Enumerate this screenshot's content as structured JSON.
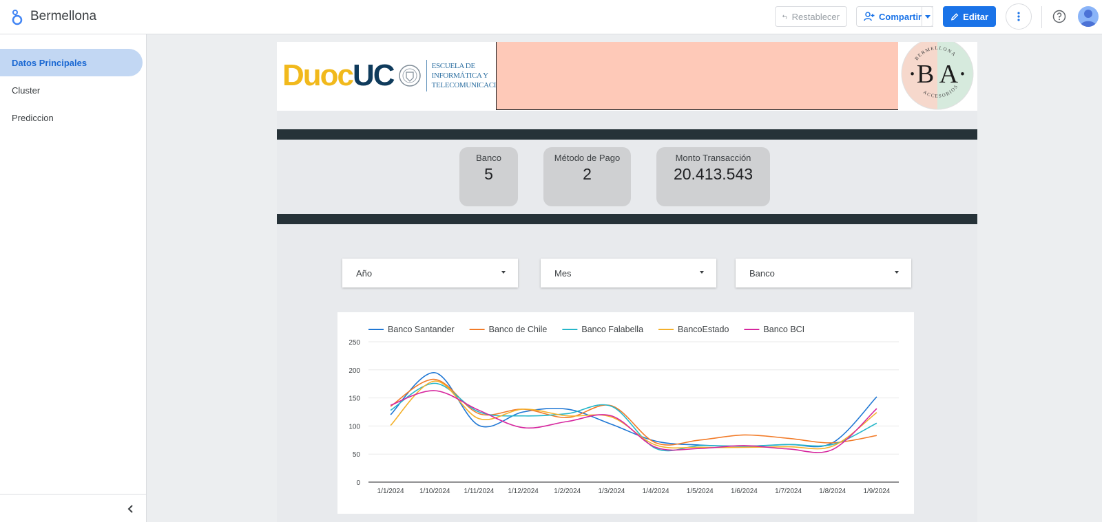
{
  "app": {
    "title": "Bermellona"
  },
  "toolbar": {
    "reset_label": "Restablecer",
    "share_label": "Compartir",
    "edit_label": "Editar"
  },
  "sidebar": {
    "items": [
      {
        "label": "Datos Principales",
        "active": true
      },
      {
        "label": "Cluster",
        "active": false
      },
      {
        "label": "Prediccion",
        "active": false
      }
    ]
  },
  "header": {
    "duoc_brand_1": "Duoc",
    "duoc_brand_2": "UC",
    "school_line_1": "Escuela de",
    "school_line_2": "Informática y",
    "school_line_3": "Telecomunicaciones",
    "ba_monogram": "·B A·",
    "ba_ring_top": "BERMELLONA",
    "ba_ring_bottom": "ACCESORIOS"
  },
  "kpis": [
    {
      "label": "Banco",
      "value": "5"
    },
    {
      "label": "Método de Pago",
      "value": "2"
    },
    {
      "label": "Monto Transacción",
      "value": "20.413.543"
    }
  ],
  "filters": [
    {
      "label": "Año"
    },
    {
      "label": "Mes"
    },
    {
      "label": "Banco"
    }
  ],
  "colors": {
    "accent": "#1a73e8",
    "salmon": "#fec9b8",
    "dark_band": "#263238",
    "kpi_bg": "#cfd0d2"
  },
  "chart_data": {
    "type": "line",
    "categories": [
      "1/1/2024",
      "1/10/2024",
      "1/11/2024",
      "1/12/2024",
      "1/2/2024",
      "1/3/2024",
      "1/4/2024",
      "1/5/2024",
      "1/6/2024",
      "1/7/2024",
      "1/8/2024",
      "1/9/2024"
    ],
    "ylim": [
      0,
      250
    ],
    "yticks": [
      0,
      50,
      100,
      150,
      200,
      250
    ],
    "grid": true,
    "legend": "top-left",
    "smooth": true,
    "series": [
      {
        "name": "Banco Santander",
        "color": "#1f77d4",
        "values": [
          120,
          195,
          101,
          125,
          130,
          103,
          73,
          66,
          64,
          67,
          70,
          152
        ]
      },
      {
        "name": "Banco de Chile",
        "color": "#f27b28",
        "values": [
          135,
          183,
          122,
          130,
          115,
          136,
          70,
          75,
          84,
          78,
          70,
          83
        ]
      },
      {
        "name": "Banco Falabella",
        "color": "#26b6c9",
        "values": [
          128,
          176,
          125,
          118,
          122,
          135,
          60,
          65,
          64,
          67,
          67,
          105
        ]
      },
      {
        "name": "BancoEstado",
        "color": "#f4b02a",
        "values": [
          101,
          180,
          113,
          130,
          118,
          116,
          66,
          62,
          62,
          63,
          64,
          124
        ]
      },
      {
        "name": "Banco BCI",
        "color": "#d6269e",
        "values": [
          137,
          163,
          128,
          97,
          108,
          118,
          62,
          60,
          65,
          59,
          58,
          131
        ]
      }
    ]
  }
}
